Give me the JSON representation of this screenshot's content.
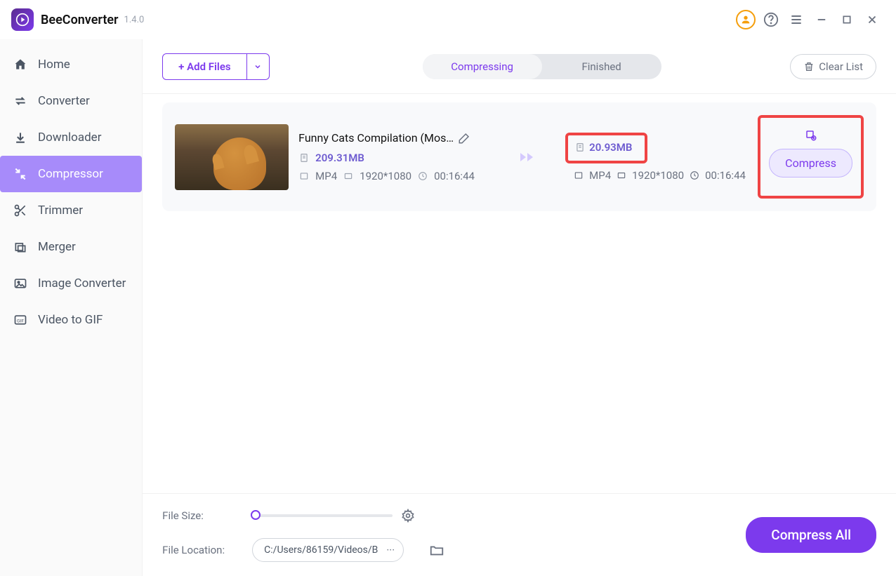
{
  "header": {
    "app_name": "BeeConverter",
    "version": "1.4.0"
  },
  "sidebar": {
    "items": [
      {
        "label": "Home"
      },
      {
        "label": "Converter"
      },
      {
        "label": "Downloader"
      },
      {
        "label": "Compressor"
      },
      {
        "label": "Trimmer"
      },
      {
        "label": "Merger"
      },
      {
        "label": "Image Converter"
      },
      {
        "label": "Video to GIF"
      }
    ]
  },
  "toolbar": {
    "add_files_label": "+ Add Files",
    "tab_compressing": "Compressing",
    "tab_finished": "Finished",
    "clear_list_label": "Clear List"
  },
  "file": {
    "title": "Funny Cats Compilation (Mos…",
    "src_size": "209.31MB",
    "src_format": "MP4",
    "src_resolution": "1920*1080",
    "src_duration": "00:16:44",
    "out_size": "20.93MB",
    "out_format": "MP4",
    "out_resolution": "1920*1080",
    "out_duration": "00:16:44",
    "compress_label": "Compress"
  },
  "footer": {
    "file_size_label": "File Size:",
    "file_location_label": "File Location:",
    "file_location_path": "C:/Users/86159/Videos/B",
    "more_label": "···",
    "compress_all_label": "Compress All"
  }
}
